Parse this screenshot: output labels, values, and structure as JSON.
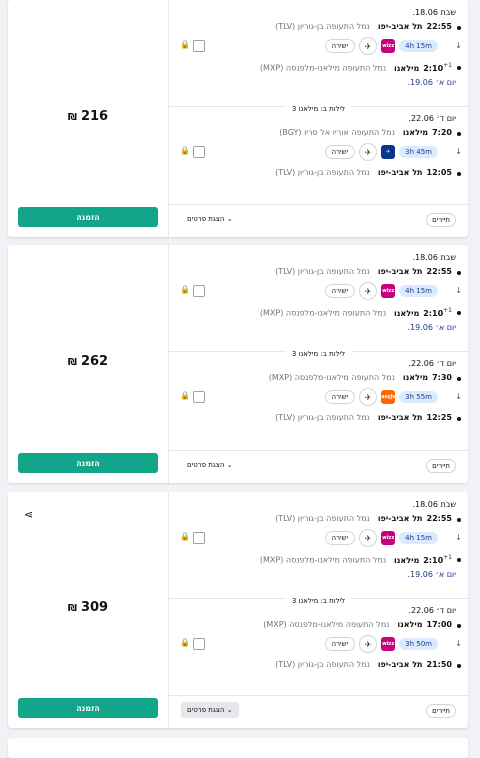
{
  "currency_symbol": "₪",
  "select_label": "הזמנה",
  "details_label": "הצגת פרטים ⌄",
  "tag_label": "תיירים",
  "stay_label": "3 לילות ב: מילאנו",
  "direct_label": "ישירה",
  "cards": [
    {
      "price": "216",
      "outbound": {
        "date": "שבת 18.06.",
        "dep_time": "22:55",
        "dep_city": "תל אביב-יפו",
        "dep_airport": "נמל התעופה בן-גוריון (TLV)",
        "duration": "4h 15m",
        "airline": "wizz",
        "arr_time": "2:10",
        "arr_sup": "+1",
        "arr_city": "מילאנו",
        "arr_airport": "נמל התעופה מילאנו-מלפנסה (MXP)",
        "arr_day": "יום א׳ 19.06."
      },
      "inbound": {
        "date": "יום ד׳ 22.06.",
        "dep_time": "7:20",
        "dep_city": "מילאנו",
        "dep_airport": "נמל התעופה אוריו אל סריו (BGY)",
        "duration": "3h 45m",
        "airline": "ryanair",
        "arr_time": "12:05",
        "arr_city": "תל אביב-יפו",
        "arr_airport": "נמל התעופה בן-גוריון (TLV)"
      }
    },
    {
      "price": "262",
      "outbound": {
        "date": "שבת 18.06.",
        "dep_time": "22:55",
        "dep_city": "תל אביב-יפו",
        "dep_airport": "נמל התעופה בן-גוריון (TLV)",
        "duration": "4h 15m",
        "airline": "wizz",
        "arr_time": "2:10",
        "arr_sup": "+1",
        "arr_city": "מילאנו",
        "arr_airport": "נמל התעופה מילאנו-מלפנסה (MXP)",
        "arr_day": "יום א׳ 19.06."
      },
      "inbound": {
        "date": "יום ד׳ 22.06.",
        "dep_time": "7:30",
        "dep_city": "מילאנו",
        "dep_airport": "נמל התעופה מילאנו-מלפנסה (MXP)",
        "duration": "3h 55m",
        "airline": "easyjet",
        "arr_time": "12:25",
        "arr_city": "תל אביב-יפו",
        "arr_airport": "נמל התעופה בן-גוריון (TLV)"
      }
    },
    {
      "price": "309",
      "outbound": {
        "date": "שבת 18.06.",
        "dep_time": "22:55",
        "dep_city": "תל אביב-יפו",
        "dep_airport": "נמל התעופה בן-גוריון (TLV)",
        "duration": "4h 15m",
        "airline": "wizz",
        "arr_time": "2:10",
        "arr_sup": "+1",
        "arr_city": "מילאנו",
        "arr_airport": "נמל התעופה מילאנו-מלפנסה (MXP)",
        "arr_day": "יום א׳ 19.06."
      },
      "inbound": {
        "date": "יום ד׳ 22.06.",
        "dep_time": "17:00",
        "dep_city": "מילאנו",
        "dep_airport": "נמל התעופה מילאנו-מלפנסה (MXP)",
        "duration": "3h 50m",
        "airline": "wizz",
        "arr_time": "21:50",
        "arr_city": "תל אביב-יפו",
        "arr_airport": "נמל התעופה בן-גוריון (TLV)"
      }
    }
  ],
  "airline_logos": {
    "wizz": {
      "text": "wizz",
      "color": "#c6007e"
    },
    "ryanair": {
      "text": "✈",
      "color": "#073590"
    },
    "easyjet": {
      "text": "easyJet",
      "color": "#ff6600"
    }
  }
}
